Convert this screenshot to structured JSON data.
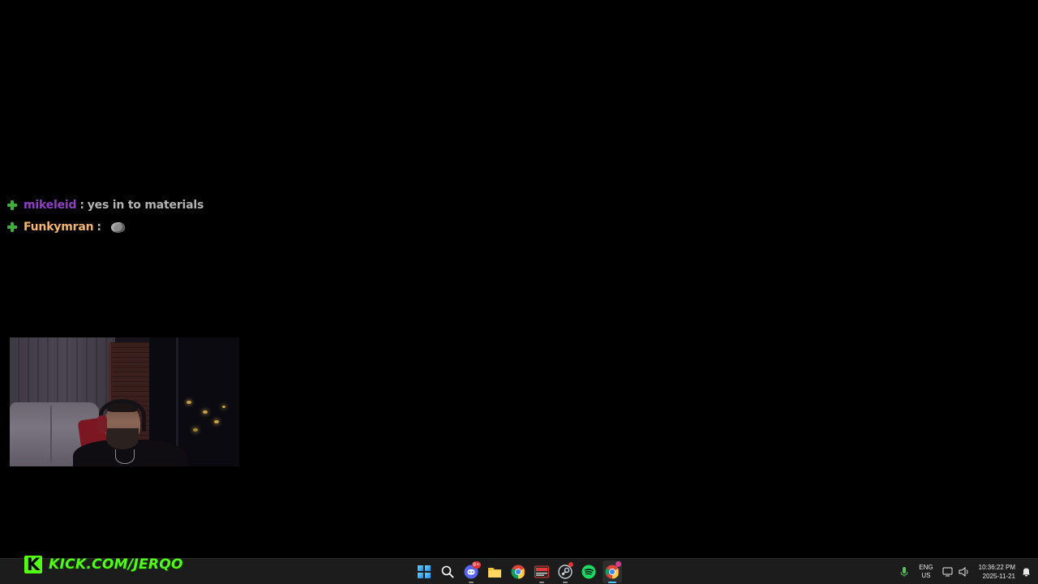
{
  "chat": {
    "messages": [
      {
        "username": "mikeleid",
        "username_color": "#8e3fc3",
        "separator": ":",
        "text": "yes in to materials",
        "emote": null
      },
      {
        "username": "Funkymran",
        "username_color": "#f5b671",
        "separator": ":",
        "text": "",
        "emote": "rock-emote"
      }
    ]
  },
  "brand": {
    "logo_letter": "K",
    "text": "KICK.COM/JERQO",
    "color": "#53fc18"
  },
  "taskbar": {
    "apps": [
      {
        "name": "windows-start-icon",
        "badge": null
      },
      {
        "name": "search-icon",
        "badge": null
      },
      {
        "name": "discord-icon",
        "badge": "9+"
      },
      {
        "name": "file-explorer-icon",
        "badge": null
      },
      {
        "name": "chrome-icon",
        "badge": null
      },
      {
        "name": "media-app-icon",
        "badge": null
      },
      {
        "name": "steam-icon",
        "badge": ""
      },
      {
        "name": "spotify-icon",
        "badge": null
      },
      {
        "name": "chrome-profile-icon",
        "badge": ""
      }
    ],
    "tray": {
      "lang_top": "ENG",
      "lang_bottom": "US",
      "time": "10:36:22 PM",
      "date": "2025-11-21"
    }
  }
}
